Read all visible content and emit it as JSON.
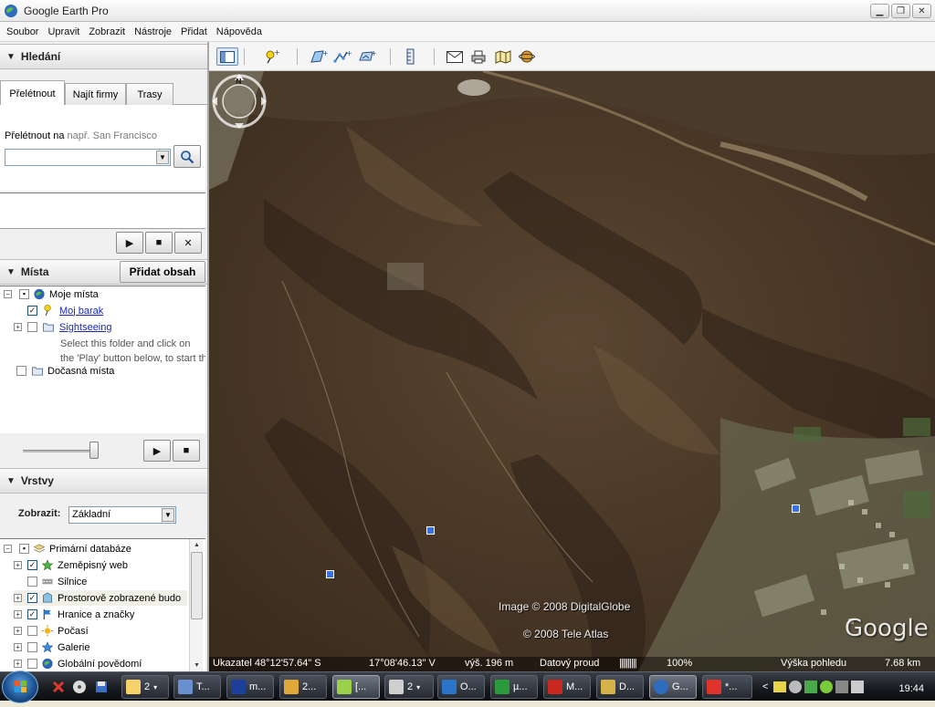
{
  "window": {
    "title": "Google Earth Pro"
  },
  "menubar": [
    "Soubor",
    "Upravit",
    "Zobrazit",
    "Nástroje",
    "Přidat",
    "Nápověda"
  ],
  "search_panel": {
    "title": "Hledání",
    "tabs": [
      "Přelétnout",
      "Najít firmy",
      "Trasy"
    ],
    "fly_label": "Přelétnout na",
    "fly_hint": "např. San Francisco",
    "input_value": ""
  },
  "places_panel": {
    "title": "Místa",
    "add_content": "Přidat obsah",
    "items": [
      {
        "label": "Moje místa",
        "checked": "partial",
        "link": false
      },
      {
        "label": "Moj barak",
        "checked": "yes",
        "link": true
      },
      {
        "label": "Sightseeing",
        "checked": "no",
        "link": true
      },
      {
        "label": "Select this folder and click on",
        "desc": true
      },
      {
        "label": "the 'Play' button below, to start th",
        "desc": true
      },
      {
        "label": "Dočasná místa",
        "checked": "no",
        "link": false
      }
    ]
  },
  "layers_panel": {
    "title": "Vrstvy",
    "show_label": "Zobrazit:",
    "show_value": "Základní",
    "items": [
      {
        "label": "Primární databáze",
        "checked": "partial"
      },
      {
        "label": "Zeměpisný web",
        "checked": "yes"
      },
      {
        "label": "Silnice",
        "checked": "no"
      },
      {
        "label": "Prostorově zobrazené budo",
        "checked": "yes",
        "highlight": true
      },
      {
        "label": "Hranice a značky",
        "checked": "yes"
      },
      {
        "label": "Počasí",
        "checked": "no"
      },
      {
        "label": "Galerie",
        "checked": "no"
      },
      {
        "label": "Globální povědomí",
        "checked": "no"
      }
    ]
  },
  "map": {
    "credit_image": "Image © 2008 DigitalGlobe",
    "credit_tele": "© 2008 Tele Atlas",
    "logo": "Google",
    "compass_label": "N",
    "status": {
      "lat": "Ukazatel 48°12'57.64\" S",
      "lon": "17°08'46.13\" V",
      "elev": "výš.   196 m",
      "stream": "Datový proud",
      "stream_bar": "||||||||||",
      "stream_pct": "100%",
      "eye_label": "Výška pohledu",
      "eye_value": "7.68 km"
    }
  },
  "taskbar": {
    "items": [
      "2",
      "T...",
      "m...",
      "2...",
      "[...",
      "2",
      "O...",
      "µ...",
      "M...",
      "D...",
      "G...",
      "*..."
    ],
    "clock": "19:44"
  }
}
